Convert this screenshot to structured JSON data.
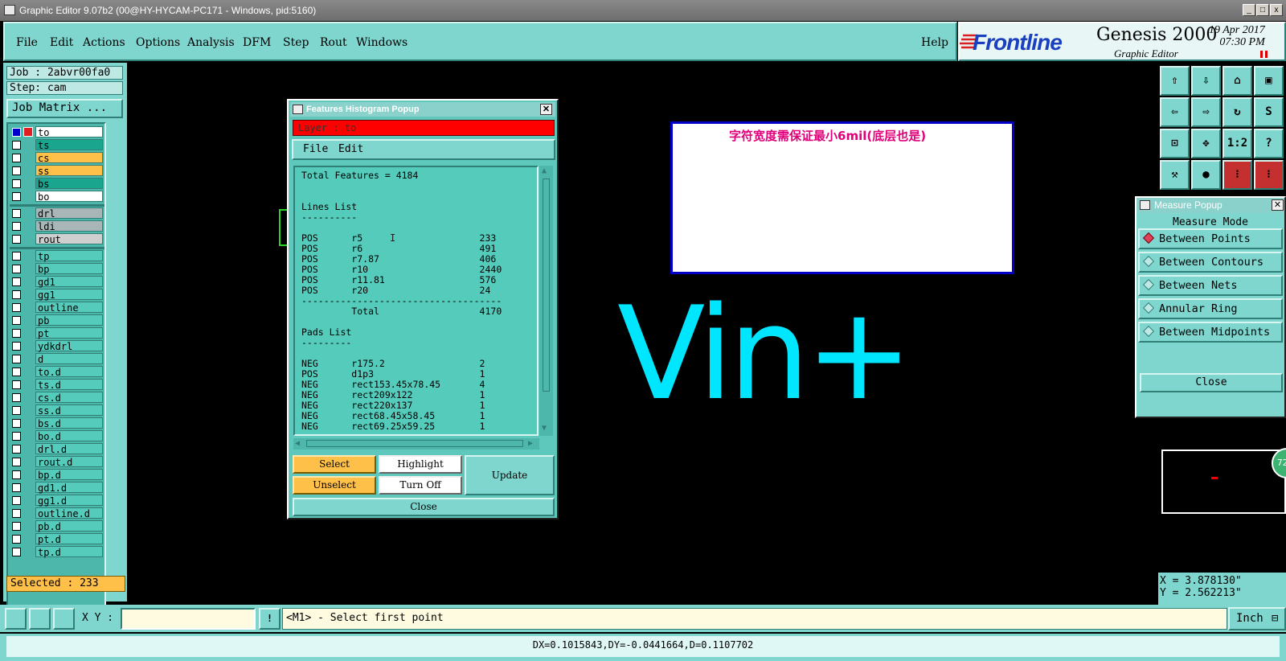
{
  "window": {
    "title": "Graphic Editor 9.07b2 (00@HY-HYCAM-PC171 - Windows, pid:5160)"
  },
  "menu": {
    "items": [
      "File",
      "Edit",
      "Actions",
      "Options",
      "Analysis",
      "DFM",
      "Step",
      "Rout",
      "Windows"
    ],
    "help": "Help"
  },
  "brand": {
    "logo": "Frontline",
    "product": "Genesis 2000",
    "subtitle": "Graphic Editor",
    "date": "19 Apr 2017",
    "time": "07:30 PM"
  },
  "job": {
    "job_label": "Job : 2abvr00fa0",
    "step_label": "Step: cam",
    "matrix_button": "Job Matrix ..."
  },
  "layers": {
    "group1": [
      {
        "name": "to",
        "color": "#ffffff"
      },
      {
        "name": "ts",
        "color": "#1aa58f"
      },
      {
        "name": "cs",
        "color": "#ffc04a"
      },
      {
        "name": "ss",
        "color": "#ffc04a"
      },
      {
        "name": "bs",
        "color": "#1aa58f"
      },
      {
        "name": "bo",
        "color": "#ffffff"
      }
    ],
    "group2": [
      {
        "name": "drl",
        "color": "#a9b6b8"
      },
      {
        "name": "ldi",
        "color": "#a9b6b8"
      },
      {
        "name": "rout",
        "color": "#cfcfcf"
      }
    ],
    "group3": [
      "tp",
      "bp",
      "gd1",
      "gg1",
      "outline",
      "pb",
      "pt",
      "ydkdrl",
      "d",
      "to.d",
      "ts.d",
      "cs.d",
      "ss.d",
      "bs.d",
      "bo.d",
      "drl.d",
      "rout.d",
      "bp.d",
      "gd1.d",
      "gg1.d",
      "outline.d",
      "pb.d",
      "pt.d",
      "tp.d"
    ],
    "group3_color": "#55cbbb"
  },
  "selected": "Selected : 233",
  "histogram": {
    "title": "Features Histogram Popup",
    "layer": "Layer :  to",
    "menu": [
      "File",
      "Edit"
    ],
    "lines": [
      "Total Features = 4184",
      "",
      "",
      "Lines List",
      "----------",
      "",
      "POS      r5                     233",
      "POS      r6                     491",
      "POS      r7.87                  406",
      "POS      r10                    2440",
      "POS      r11.81                 576",
      "POS      r20                    24",
      "------------------------------------",
      "         Total                  4170",
      "",
      "Pads List",
      "---------",
      "",
      "NEG      r175.2                 2",
      "POS      d1p3                   1",
      "NEG      rect153.45x78.45       4",
      "NEG      rect209x122            1",
      "NEG      rect220x137            1",
      "NEG      rect68.45x58.45        1",
      "NEG      rect69.25x59.25        1"
    ],
    "buttons": {
      "select": "Select",
      "highlight": "Highlight",
      "update": "Update",
      "unselect": "Unselect",
      "turn_off": "Turn Off",
      "close": "Close"
    }
  },
  "note": {
    "text": "字符宽度需保证最小6mil(底层也是)"
  },
  "canvas_text": "Vin+",
  "toolbox": {
    "ratio_label": "1:2",
    "help_label": "?"
  },
  "measure": {
    "title": "Measure Popup",
    "mode_label": "Measure Mode",
    "options": [
      "Between Points",
      "Between Contours",
      "Between Nets",
      "Annular Ring",
      "Between Midpoints"
    ],
    "selected_option": "Between Points",
    "close": "Close"
  },
  "zoom_badge": "72",
  "coords": {
    "x": "X = 3.878130\"",
    "y": "Y = 2.562213\""
  },
  "bottom": {
    "xy_label": "X Y :",
    "xy_value": "",
    "prompt": "<M1> - Select first point",
    "units": "Inch"
  },
  "status": "DX=0.1015843,DY=-0.0441664,D=0.1107702"
}
